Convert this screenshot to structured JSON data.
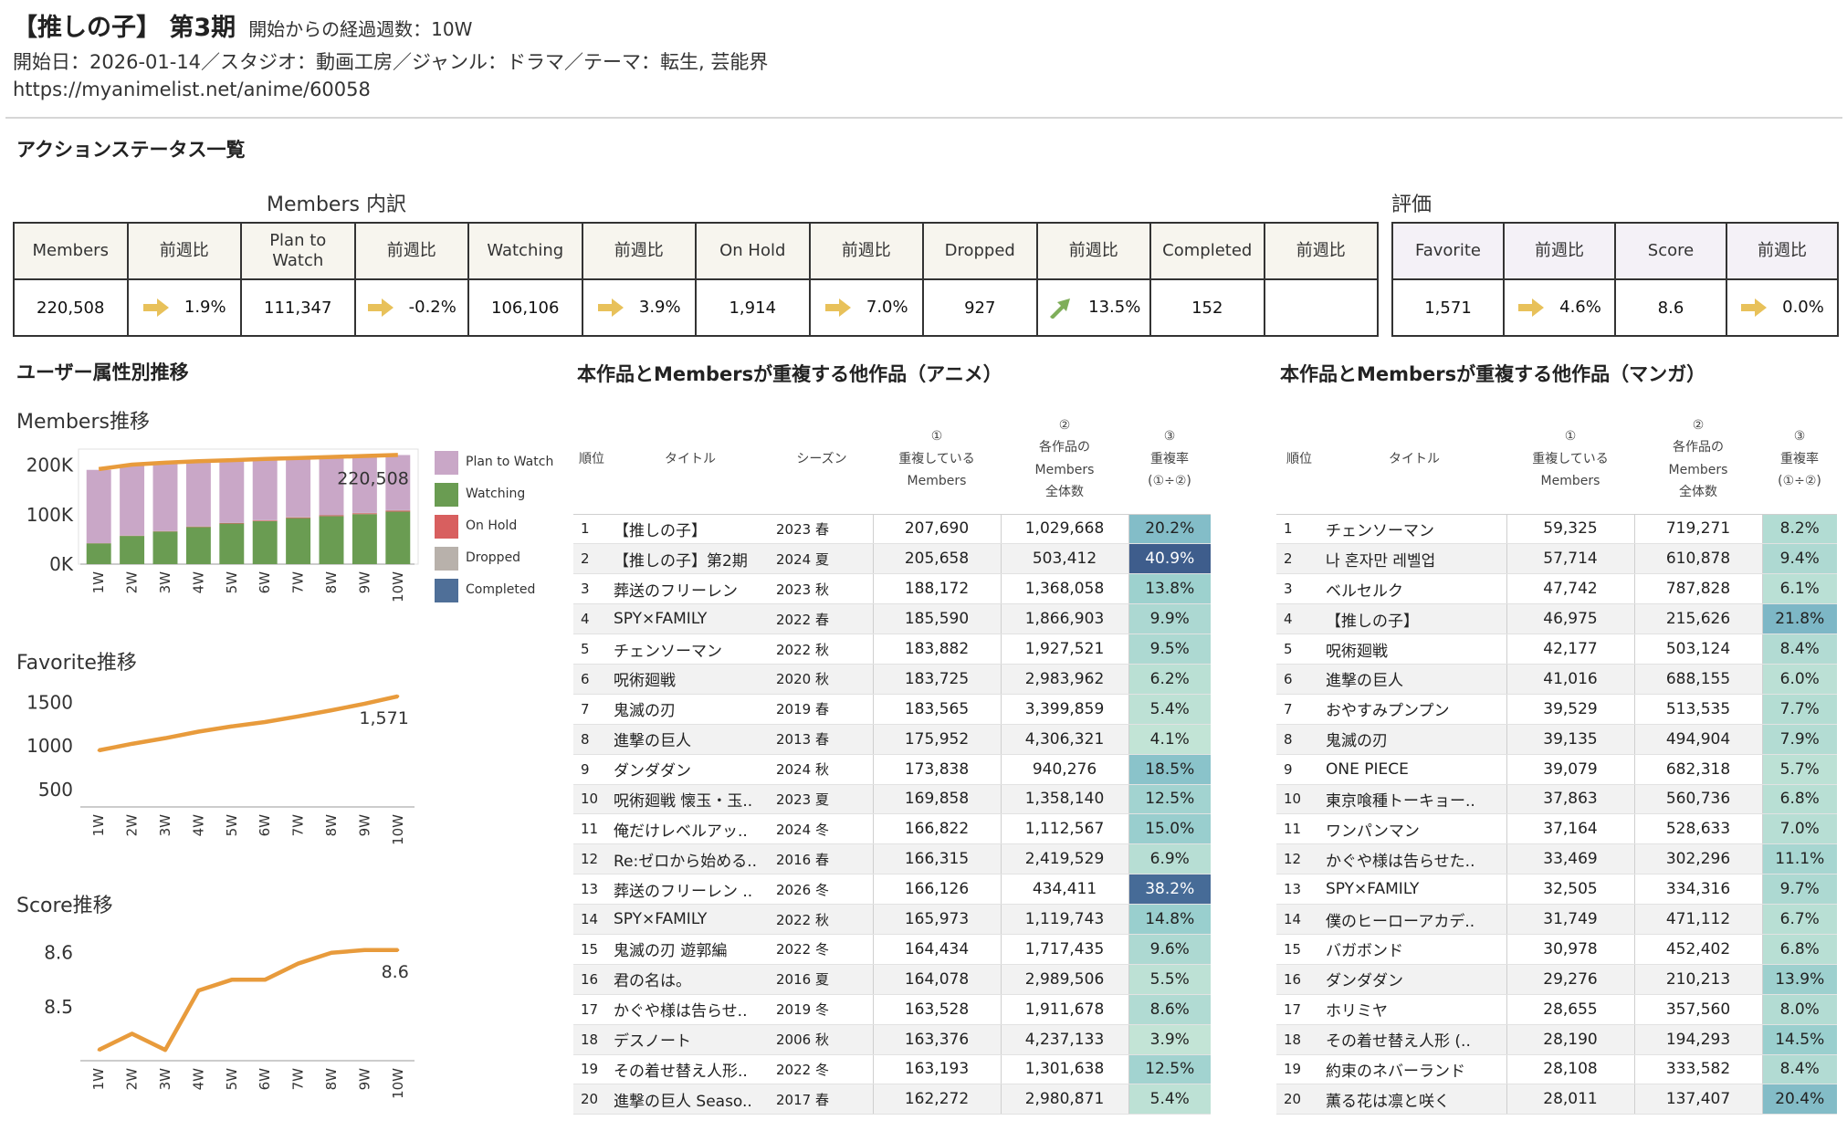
{
  "header": {
    "title": "【推しの子】 第3期",
    "weeks": "開始からの経過週数：10W",
    "meta": "開始日：2026-01-14／スタジオ：動画工房／ジャンル：ドラマ／テーマ：転生, 芸能界",
    "url": "https://myanimelist.net/anime/60058"
  },
  "action_status": {
    "title": "アクションステータス一覧",
    "members_group_label": "Members 内訳",
    "rating_group_label": "評価",
    "members_columns": [
      {
        "label": "Members",
        "value": "220,508"
      },
      {
        "label": "前週比",
        "value": "1.9%",
        "trend": "flat"
      },
      {
        "label": "Plan to Watch",
        "value": "111,347"
      },
      {
        "label": "前週比",
        "value": "-0.2%",
        "trend": "flat"
      },
      {
        "label": "Watching",
        "value": "106,106"
      },
      {
        "label": "前週比",
        "value": "3.9%",
        "trend": "flat"
      },
      {
        "label": "On Hold",
        "value": "1,914"
      },
      {
        "label": "前週比",
        "value": "7.0%",
        "trend": "flat"
      },
      {
        "label": "Dropped",
        "value": "927"
      },
      {
        "label": "前週比",
        "value": "13.5%",
        "trend": "up"
      },
      {
        "label": "Completed",
        "value": "152"
      },
      {
        "label": "前週比",
        "value": "",
        "trend": "none"
      }
    ],
    "rating_columns": [
      {
        "label": "Favorite",
        "value": "1,571"
      },
      {
        "label": "前週比",
        "value": "4.6%",
        "trend": "flat"
      },
      {
        "label": "Score",
        "value": "8.6"
      },
      {
        "label": "前週比",
        "value": "0.0%",
        "trend": "flat"
      }
    ],
    "colors": {
      "arrow_flat": "#e8c15a",
      "arrow_up": "#7fae5a"
    }
  },
  "user_trend": {
    "title": "ユーザー属性別推移"
  },
  "chart_data": [
    {
      "type": "bar",
      "title": "Members推移",
      "categories": [
        "1W",
        "2W",
        "3W",
        "4W",
        "5W",
        "6W",
        "7W",
        "8W",
        "9W",
        "10W"
      ],
      "stacked": true,
      "series": [
        {
          "name": "Plan to Watch",
          "color": "#c9a7c7",
          "values": [
            148000,
            143000,
            137000,
            131000,
            127000,
            123000,
            119000,
            116000,
            113000,
            111347
          ]
        },
        {
          "name": "Watching",
          "color": "#6a9c52",
          "values": [
            42000,
            57000,
            66000,
            75000,
            82000,
            87000,
            93000,
            97000,
            101000,
            106106
          ]
        },
        {
          "name": "On Hold",
          "color": "#d85f5f",
          "values": [
            300,
            500,
            700,
            900,
            1100,
            1300,
            1500,
            1650,
            1800,
            1914
          ]
        },
        {
          "name": "Dropped",
          "color": "#b8b1ab",
          "values": [
            150,
            250,
            350,
            450,
            550,
            650,
            720,
            800,
            870,
            927
          ]
        },
        {
          "name": "Completed",
          "color": "#4f6f98",
          "values": [
            0,
            0,
            0,
            0,
            0,
            30,
            60,
            90,
            120,
            152
          ]
        }
      ],
      "line": {
        "name": "Members",
        "color": "#e89b3c",
        "values": [
          192000,
          201000,
          205000,
          208000,
          210000,
          212500,
          214500,
          216500,
          218500,
          220508
        ]
      },
      "last_label": "220,508",
      "yticks": [
        "200K",
        "100K",
        "0K"
      ],
      "ylim": [
        0,
        225000
      ],
      "legend": "right"
    },
    {
      "type": "line",
      "title": "Favorite推移",
      "categories": [
        "1W",
        "2W",
        "3W",
        "4W",
        "5W",
        "6W",
        "7W",
        "8W",
        "9W",
        "10W"
      ],
      "values": [
        950,
        1025,
        1090,
        1165,
        1225,
        1275,
        1340,
        1410,
        1485,
        1571
      ],
      "color": "#e89b3c",
      "last_label": "1,571",
      "yticks": [
        "1500",
        "1000",
        "500"
      ],
      "ylim": [
        300,
        1600
      ]
    },
    {
      "type": "line",
      "title": "Score推移",
      "categories": [
        "1W",
        "2W",
        "3W",
        "4W",
        "5W",
        "6W",
        "7W",
        "8W",
        "9W",
        "10W"
      ],
      "values": [
        8.42,
        8.45,
        8.42,
        8.53,
        8.55,
        8.55,
        8.58,
        8.6,
        8.605,
        8.605
      ],
      "color": "#e89b3c",
      "last_label": "8.6",
      "yticks": [
        "8.6",
        "8.5"
      ],
      "ylim": [
        8.4,
        8.63
      ]
    }
  ],
  "anime_table": {
    "title": "本作品とMembersが重複する他作品（アニメ）",
    "headers": {
      "rank": "順位",
      "title": "タイトル",
      "season": "シーズン",
      "overlap": "①\n重複している\nMembers",
      "total": "②\n各作品の\nMembers\n全体数",
      "rate": "③\n重複率\n(①÷②)"
    },
    "rows": [
      {
        "rank": "1",
        "title": "【推しの子】",
        "season": "2023 春",
        "overlap": "207,690",
        "total": "1,029,668",
        "rate": "20.2%",
        "r": 20.2
      },
      {
        "rank": "2",
        "title": "【推しの子】第2期",
        "season": "2024 夏",
        "overlap": "205,658",
        "total": "503,412",
        "rate": "40.9%",
        "r": 40.9
      },
      {
        "rank": "3",
        "title": "葬送のフリーレン",
        "season": "2023 秋",
        "overlap": "188,172",
        "total": "1,368,058",
        "rate": "13.8%",
        "r": 13.8
      },
      {
        "rank": "4",
        "title": "SPY×FAMILY",
        "season": "2022 春",
        "overlap": "185,590",
        "total": "1,866,903",
        "rate": "9.9%",
        "r": 9.9
      },
      {
        "rank": "5",
        "title": "チェンソーマン",
        "season": "2022 秋",
        "overlap": "183,882",
        "total": "1,927,521",
        "rate": "9.5%",
        "r": 9.5
      },
      {
        "rank": "6",
        "title": "呪術廻戦",
        "season": "2020 秋",
        "overlap": "183,725",
        "total": "2,983,962",
        "rate": "6.2%",
        "r": 6.2
      },
      {
        "rank": "7",
        "title": "鬼滅の刃",
        "season": "2019 春",
        "overlap": "183,565",
        "total": "3,399,859",
        "rate": "5.4%",
        "r": 5.4
      },
      {
        "rank": "8",
        "title": "進撃の巨人",
        "season": "2013 春",
        "overlap": "175,952",
        "total": "4,306,321",
        "rate": "4.1%",
        "r": 4.1
      },
      {
        "rank": "9",
        "title": "ダンダダン",
        "season": "2024 秋",
        "overlap": "173,838",
        "total": "940,276",
        "rate": "18.5%",
        "r": 18.5
      },
      {
        "rank": "10",
        "title": "呪術廻戦 懐玉・玉..",
        "season": "2023 夏",
        "overlap": "169,858",
        "total": "1,358,140",
        "rate": "12.5%",
        "r": 12.5
      },
      {
        "rank": "11",
        "title": "俺だけレベルアッ..",
        "season": "2024 冬",
        "overlap": "166,822",
        "total": "1,112,567",
        "rate": "15.0%",
        "r": 15.0
      },
      {
        "rank": "12",
        "title": "Re:ゼロから始める..",
        "season": "2016 春",
        "overlap": "166,315",
        "total": "2,419,529",
        "rate": "6.9%",
        "r": 6.9
      },
      {
        "rank": "13",
        "title": "葬送のフリーレン ..",
        "season": "2026 冬",
        "overlap": "166,126",
        "total": "434,411",
        "rate": "38.2%",
        "r": 38.2
      },
      {
        "rank": "14",
        "title": "SPY×FAMILY",
        "season": "2022 秋",
        "overlap": "165,973",
        "total": "1,119,743",
        "rate": "14.8%",
        "r": 14.8
      },
      {
        "rank": "15",
        "title": "鬼滅の刃 遊郭編",
        "season": "2022 冬",
        "overlap": "164,434",
        "total": "1,717,435",
        "rate": "9.6%",
        "r": 9.6
      },
      {
        "rank": "16",
        "title": "君の名は。",
        "season": "2016 夏",
        "overlap": "164,078",
        "total": "2,989,506",
        "rate": "5.5%",
        "r": 5.5
      },
      {
        "rank": "17",
        "title": "かぐや様は告らせ..",
        "season": "2019 冬",
        "overlap": "163,528",
        "total": "1,911,678",
        "rate": "8.6%",
        "r": 8.6
      },
      {
        "rank": "18",
        "title": "デスノート",
        "season": "2006 秋",
        "overlap": "163,376",
        "total": "4,237,133",
        "rate": "3.9%",
        "r": 3.9
      },
      {
        "rank": "19",
        "title": "その着せ替え人形..",
        "season": "2022 冬",
        "overlap": "163,193",
        "total": "1,301,638",
        "rate": "12.5%",
        "r": 12.5
      },
      {
        "rank": "20",
        "title": "進撃の巨人 Seaso..",
        "season": "2017 春",
        "overlap": "162,272",
        "total": "2,980,871",
        "rate": "5.4%",
        "r": 5.4
      }
    ]
  },
  "manga_table": {
    "title": "本作品とMembersが重複する他作品（マンガ）",
    "headers": {
      "rank": "順位",
      "title": "タイトル",
      "overlap": "①\n重複している\nMembers",
      "total": "②\n各作品の\nMembers\n全体数",
      "rate": "③\n重複率\n(①÷②)"
    },
    "rows": [
      {
        "rank": "1",
        "title": "チェンソーマン",
        "overlap": "59,325",
        "total": "719,271",
        "rate": "8.2%",
        "r": 8.2
      },
      {
        "rank": "2",
        "title": "나 혼자만 레벨업",
        "overlap": "57,714",
        "total": "610,878",
        "rate": "9.4%",
        "r": 9.4
      },
      {
        "rank": "3",
        "title": "ベルセルク",
        "overlap": "47,742",
        "total": "787,828",
        "rate": "6.1%",
        "r": 6.1
      },
      {
        "rank": "4",
        "title": "【推しの子】",
        "overlap": "46,975",
        "total": "215,626",
        "rate": "21.8%",
        "r": 21.8
      },
      {
        "rank": "5",
        "title": "呪術廻戦",
        "overlap": "42,177",
        "total": "503,124",
        "rate": "8.4%",
        "r": 8.4
      },
      {
        "rank": "6",
        "title": "進撃の巨人",
        "overlap": "41,016",
        "total": "688,155",
        "rate": "6.0%",
        "r": 6.0
      },
      {
        "rank": "7",
        "title": "おやすみプンプン",
        "overlap": "39,529",
        "total": "513,535",
        "rate": "7.7%",
        "r": 7.7
      },
      {
        "rank": "8",
        "title": "鬼滅の刃",
        "overlap": "39,135",
        "total": "494,904",
        "rate": "7.9%",
        "r": 7.9
      },
      {
        "rank": "9",
        "title": "ONE PIECE",
        "overlap": "39,079",
        "total": "682,318",
        "rate": "5.7%",
        "r": 5.7
      },
      {
        "rank": "10",
        "title": "東京喰種トーキョー..",
        "overlap": "37,863",
        "total": "560,736",
        "rate": "6.8%",
        "r": 6.8
      },
      {
        "rank": "11",
        "title": "ワンパンマン",
        "overlap": "37,164",
        "total": "528,633",
        "rate": "7.0%",
        "r": 7.0
      },
      {
        "rank": "12",
        "title": "かぐや様は告らせた..",
        "overlap": "33,469",
        "total": "302,296",
        "rate": "11.1%",
        "r": 11.1
      },
      {
        "rank": "13",
        "title": "SPY×FAMILY",
        "overlap": "32,505",
        "total": "334,316",
        "rate": "9.7%",
        "r": 9.7
      },
      {
        "rank": "14",
        "title": "僕のヒーローアカデ..",
        "overlap": "31,749",
        "total": "471,112",
        "rate": "6.7%",
        "r": 6.7
      },
      {
        "rank": "15",
        "title": "バガボンド",
        "overlap": "30,978",
        "total": "452,402",
        "rate": "6.8%",
        "r": 6.8
      },
      {
        "rank": "16",
        "title": "ダンダダン",
        "overlap": "29,276",
        "total": "210,213",
        "rate": "13.9%",
        "r": 13.9
      },
      {
        "rank": "17",
        "title": "ホリミヤ",
        "overlap": "28,655",
        "total": "357,560",
        "rate": "8.0%",
        "r": 8.0
      },
      {
        "rank": "18",
        "title": "その着せ替え人形 (..",
        "overlap": "28,190",
        "total": "194,293",
        "rate": "14.5%",
        "r": 14.5
      },
      {
        "rank": "19",
        "title": "約束のネバーランド",
        "overlap": "28,108",
        "total": "333,582",
        "rate": "8.4%",
        "r": 8.4
      },
      {
        "rank": "20",
        "title": "薫る花は凛と咲く",
        "overlap": "28,011",
        "total": "137,407",
        "rate": "20.4%",
        "r": 20.4
      }
    ]
  }
}
